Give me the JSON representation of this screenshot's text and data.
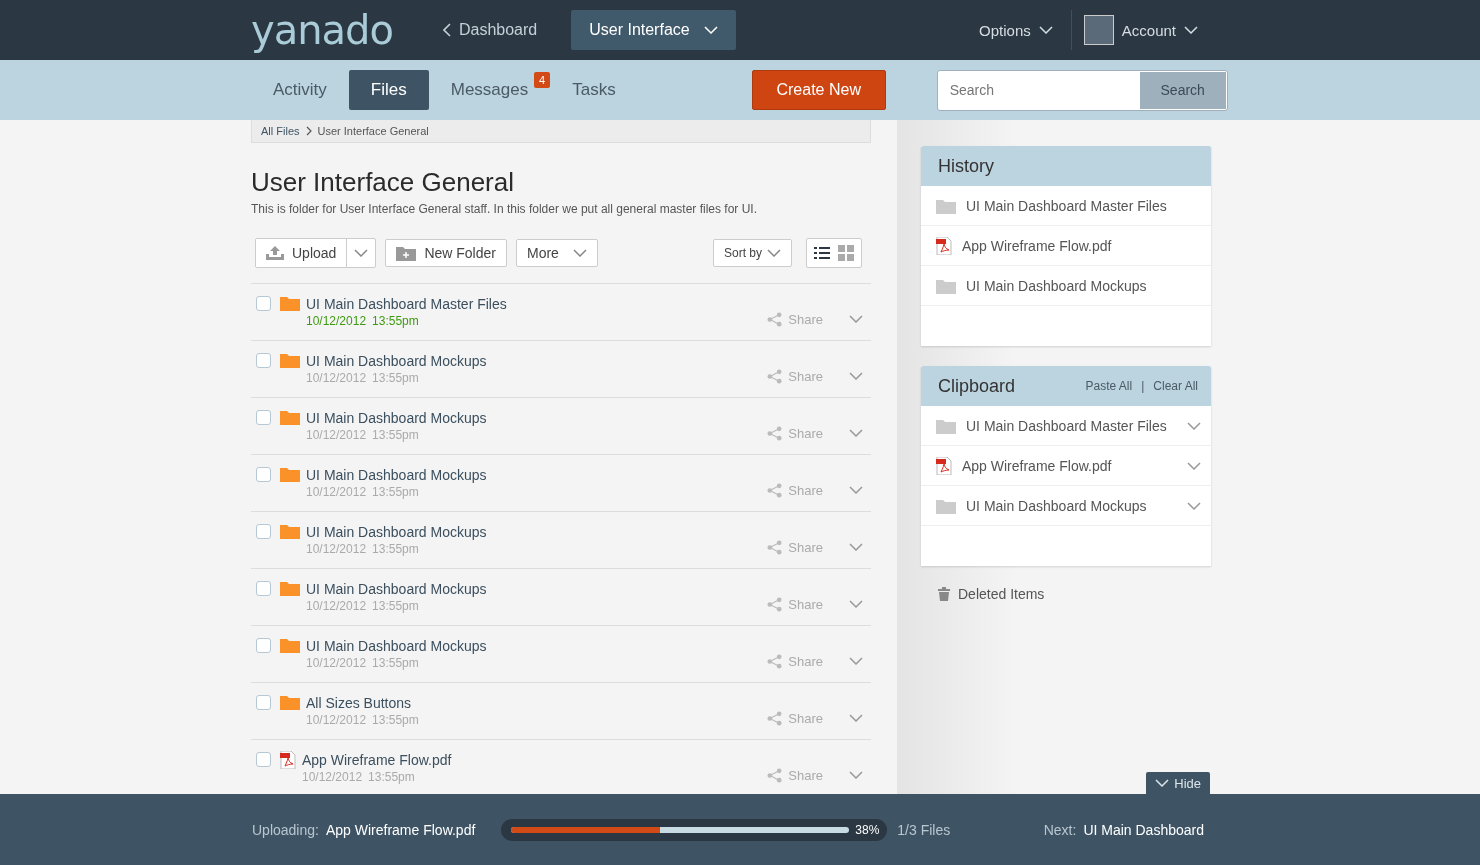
{
  "topbar": {
    "logo": "yanado",
    "back_link": "Dashboard",
    "project": "User Interface",
    "options": "Options",
    "account": "Account"
  },
  "tabs": [
    {
      "label": "Activity",
      "selected": false
    },
    {
      "label": "Files",
      "selected": true
    },
    {
      "label": "Messages",
      "selected": false,
      "badge": "4"
    },
    {
      "label": "Tasks",
      "selected": false
    }
  ],
  "create_button": "Create New",
  "search": {
    "placeholder": "Search",
    "button": "Search"
  },
  "breadcrumb": [
    "All Files",
    "User Interface General"
  ],
  "folder": {
    "title": "User Interface General",
    "description": "This is folder for User Interface General staff. In this folder we put all general master files for UI."
  },
  "toolbar": {
    "upload": "Upload",
    "new_folder": "New Folder",
    "more": "More",
    "sort": "Sort by",
    "view_modes": [
      {
        "kind": "list",
        "selected": true
      },
      {
        "kind": "grid",
        "selected": false
      }
    ]
  },
  "files": [
    {
      "kind": "folder",
      "name": "UI Main Dashboard Master Files",
      "date": "10/12/2012",
      "time": "13:55pm",
      "checked": false,
      "selected": true,
      "share": "Share"
    },
    {
      "kind": "folder",
      "name": "UI Main Dashboard Mockups",
      "date": "10/12/2012",
      "time": "13:55pm",
      "checked": false,
      "selected": false,
      "share": "Share"
    },
    {
      "kind": "folder",
      "name": "UI Main Dashboard Mockups",
      "date": "10/12/2012",
      "time": "13:55pm",
      "checked": false,
      "selected": false,
      "share": "Share"
    },
    {
      "kind": "folder",
      "name": "UI Main Dashboard Mockups",
      "date": "10/12/2012",
      "time": "13:55pm",
      "checked": false,
      "selected": false,
      "share": "Share"
    },
    {
      "kind": "folder",
      "name": "UI Main Dashboard Mockups",
      "date": "10/12/2012",
      "time": "13:55pm",
      "checked": false,
      "selected": false,
      "share": "Share"
    },
    {
      "kind": "folder",
      "name": "UI Main Dashboard Mockups",
      "date": "10/12/2012",
      "time": "13:55pm",
      "checked": false,
      "selected": false,
      "share": "Share"
    },
    {
      "kind": "folder",
      "name": "UI Main Dashboard Mockups",
      "date": "10/12/2012",
      "time": "13:55pm",
      "checked": false,
      "selected": false,
      "share": "Share"
    },
    {
      "kind": "folder",
      "name": "All Sizes Buttons",
      "date": "10/12/2012",
      "time": "13:55pm",
      "checked": false,
      "selected": false,
      "share": "Share"
    },
    {
      "kind": "pdf",
      "name": "App Wireframe Flow.pdf",
      "date": "10/12/2012",
      "time": "13:55pm",
      "checked": false,
      "selected": false,
      "share": "Share"
    }
  ],
  "history": {
    "title": "History",
    "items": [
      {
        "kind": "folder",
        "name": "UI Main Dashboard Master Files"
      },
      {
        "kind": "pdf",
        "name": "App Wireframe Flow.pdf"
      },
      {
        "kind": "folder",
        "name": "UI Main Dashboard Mockups"
      }
    ]
  },
  "clipboard": {
    "title": "Clipboard",
    "paste_all": "Paste All",
    "separator": "|",
    "clear_all": "Clear All",
    "items": [
      {
        "kind": "folder",
        "name": "UI Main Dashboard Master Files"
      },
      {
        "kind": "pdf",
        "name": "App Wireframe Flow.pdf"
      },
      {
        "kind": "folder",
        "name": "UI Main Dashboard Mockups"
      }
    ]
  },
  "deleted_items": "Deleted Items",
  "upload_bar": {
    "hide": "Hide",
    "label": "Uploading:",
    "file": "App Wireframe Flow.pdf",
    "level": 0.44,
    "percent": "38%",
    "count": "1/3 Files",
    "next_label": "Next:",
    "next_file": "UI Main Dashboard"
  }
}
